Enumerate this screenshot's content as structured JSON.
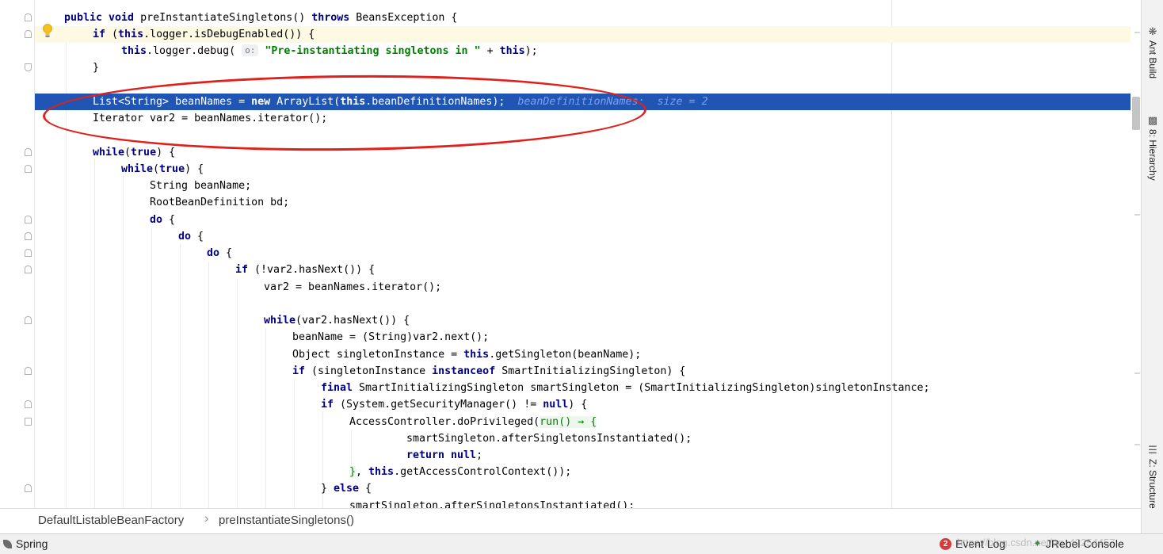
{
  "editor": {
    "lines": [
      {
        "parts": [
          [
            "kw",
            "public void "
          ],
          [
            "",
            "preInstantiateSingletons() "
          ],
          [
            "kw",
            "throws "
          ],
          [
            "",
            "BeansException {"
          ]
        ]
      },
      {
        "parts": [
          [
            "kw",
            "if "
          ],
          [
            "",
            "("
          ],
          [
            "kw",
            "this"
          ],
          [
            "",
            ".logger.isDebugEnabled()) {"
          ]
        ]
      },
      {
        "parts": [
          [
            "kw",
            "this"
          ],
          [
            "",
            ".logger.debug( "
          ],
          [
            "inlay",
            "o:"
          ],
          [
            "",
            " "
          ],
          [
            "str",
            "\"Pre-instantiating singletons in \""
          ],
          [
            "",
            " + "
          ],
          [
            "kw",
            "this"
          ],
          [
            "",
            ");"
          ]
        ]
      },
      {
        "parts": [
          [
            "",
            "}"
          ]
        ]
      },
      {
        "parts": [
          [
            "",
            "List<String> beanNames = "
          ],
          [
            "kw",
            "new "
          ],
          [
            "",
            "ArrayList("
          ],
          [
            "kw",
            "this"
          ],
          [
            "",
            ".beanDefinitionNames);  "
          ],
          [
            "hint",
            "beanDefinitionNames:  size = 2"
          ]
        ]
      },
      {
        "parts": [
          [
            "",
            "Iterator var2 = beanNames.iterator();"
          ]
        ]
      },
      {
        "parts": [
          [
            "kw",
            "while"
          ],
          [
            "",
            "("
          ],
          [
            "kw",
            "true"
          ],
          [
            "",
            ") {"
          ]
        ]
      },
      {
        "parts": [
          [
            "kw",
            "while"
          ],
          [
            "",
            "("
          ],
          [
            "kw",
            "true"
          ],
          [
            "",
            ") {"
          ]
        ]
      },
      {
        "parts": [
          [
            "",
            "String beanName;"
          ]
        ]
      },
      {
        "parts": [
          [
            "",
            "RootBeanDefinition bd;"
          ]
        ]
      },
      {
        "parts": [
          [
            "kw",
            "do "
          ],
          [
            "",
            "{"
          ]
        ]
      },
      {
        "parts": [
          [
            "kw",
            "do "
          ],
          [
            "",
            "{"
          ]
        ]
      },
      {
        "parts": [
          [
            "kw",
            "do "
          ],
          [
            "",
            "{"
          ]
        ]
      },
      {
        "parts": [
          [
            "kw",
            "if "
          ],
          [
            "",
            "(!var2.hasNext()) {"
          ]
        ]
      },
      {
        "parts": [
          [
            "",
            "var2 = beanNames.iterator();"
          ]
        ]
      },
      {
        "parts": [
          [
            "kw",
            "while"
          ],
          [
            "",
            "(var2.hasNext()) {"
          ]
        ]
      },
      {
        "parts": [
          [
            "",
            "beanName = (String)var2.next();"
          ]
        ]
      },
      {
        "parts": [
          [
            "",
            "Object singletonInstance = "
          ],
          [
            "kw",
            "this"
          ],
          [
            "",
            ".getSingleton(beanName);"
          ]
        ]
      },
      {
        "parts": [
          [
            "kw",
            "if "
          ],
          [
            "",
            "(singletonInstance "
          ],
          [
            "kw",
            "instanceof "
          ],
          [
            "",
            "SmartInitializingSingleton) {"
          ]
        ]
      },
      {
        "parts": [
          [
            "kw",
            "final "
          ],
          [
            "",
            "SmartInitializingSingleton smartSingleton = (SmartInitializingSingleton)singletonInstance;"
          ]
        ]
      },
      {
        "parts": [
          [
            "kw",
            "if "
          ],
          [
            "",
            "(System.getSecurityManager() != "
          ],
          [
            "kw",
            "null"
          ],
          [
            "",
            ") {"
          ]
        ]
      },
      {
        "parts": [
          [
            "",
            "AccessController.doPrivileged("
          ],
          [
            "lambda",
            "run() → {"
          ]
        ]
      },
      {
        "parts": [
          [
            "",
            "smartSingleton.afterSingletonsInstantiated();"
          ]
        ]
      },
      {
        "parts": [
          [
            "kw",
            "return null"
          ],
          [
            "",
            ";"
          ]
        ]
      },
      {
        "parts": [
          [
            "lambda",
            "}"
          ],
          [
            "",
            ", "
          ],
          [
            "kw",
            "this"
          ],
          [
            "",
            ".getAccessControlContext());"
          ]
        ]
      },
      {
        "parts": [
          [
            "",
            "} "
          ],
          [
            "kw",
            "else "
          ],
          [
            "",
            "{"
          ]
        ]
      },
      {
        "parts": [
          [
            "",
            "smartSingleton.afterSingletonsInstantiated();"
          ]
        ]
      }
    ]
  },
  "breadcrumb": {
    "class_name": "DefaultListableBeanFactory",
    "separator": "›",
    "method_name": "preInstantiateSingletons()"
  },
  "sidebar": {
    "ant_build": "Ant Build",
    "hierarchy": "8: Hierarchy",
    "structure": "Z: Structure"
  },
  "statusbar": {
    "spring": "Spring",
    "event_log": "Event Log",
    "event_count": "2",
    "jrebel": "JRebel Console",
    "watermark": "https://blog.csdn.net/qq_42254457"
  },
  "colors": {
    "execution_line": "#2155b4",
    "keyword": "#000080",
    "string": "#008000",
    "annotation_oval": "#e0201a"
  }
}
